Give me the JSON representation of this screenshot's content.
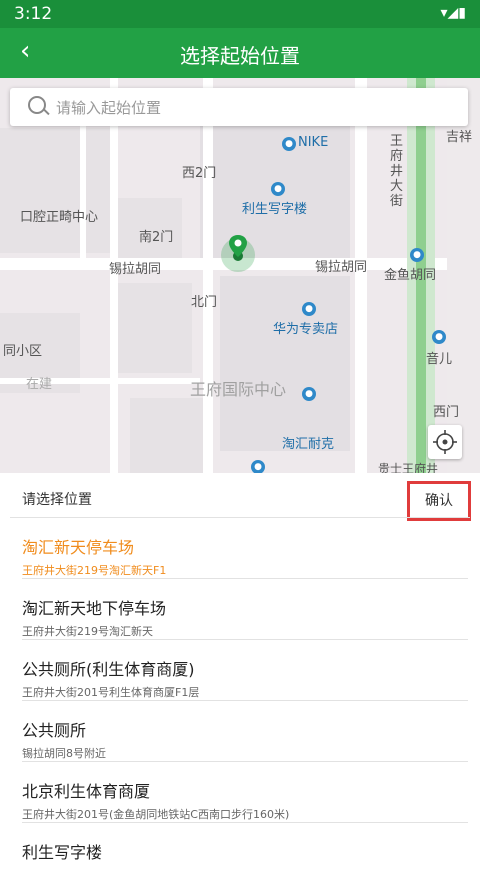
{
  "statusbar": {
    "time": "3:12",
    "icons": "▾◢▮"
  },
  "appbar": {
    "back_icon": "‹",
    "title": "选择起始位置"
  },
  "search": {
    "placeholder": "请输入起始位置"
  },
  "map": {
    "labels": {
      "nike": "NIKE",
      "xi2men": "西2门",
      "lishengxiezilou": "利生写字楼",
      "kouqiang": "口腔正畸中心",
      "nan2men": "南2门",
      "xila_left": "锡拉胡同",
      "xila_right": "锡拉胡同",
      "jinyu": "金鱼胡同",
      "beimen": "北门",
      "huawei": "华为专卖店",
      "tongxiaoqu": "同小区",
      "zaijian": "在建",
      "wangfu_center": "王府国际中心",
      "naike": "淘汇耐克",
      "ximen": "西门",
      "yinger": "音儿",
      "wangfujing_v": "王府井大街",
      "jisheng": "吉祥",
      "bottom_partial": "贵士王府井"
    }
  },
  "confirm_row": {
    "label": "请选择位置",
    "confirm_label": "确认"
  },
  "results": [
    {
      "name": "淘汇新天停车场",
      "address": "王府井大街219号淘汇新天F1",
      "selected": true
    },
    {
      "name": "淘汇新天地下停车场",
      "address": "王府井大街219号淘汇新天",
      "selected": false
    },
    {
      "name": "公共厕所(利生体育商厦)",
      "address": "王府井大街201号利生体育商厦F1层",
      "selected": false
    },
    {
      "name": "公共厕所",
      "address": "锡拉胡同8号附近",
      "selected": false
    },
    {
      "name": "北京利生体育商厦",
      "address": "王府井大街201号(金鱼胡同地铁站C西南口步行160米)",
      "selected": false
    },
    {
      "name": "利生写字楼",
      "address": "",
      "selected": false
    }
  ],
  "colors": {
    "primary": "#22a145",
    "statusbar": "#1a8f3a",
    "accent_orange": "#f08c1d",
    "highlight_red": "#e03c3c"
  }
}
